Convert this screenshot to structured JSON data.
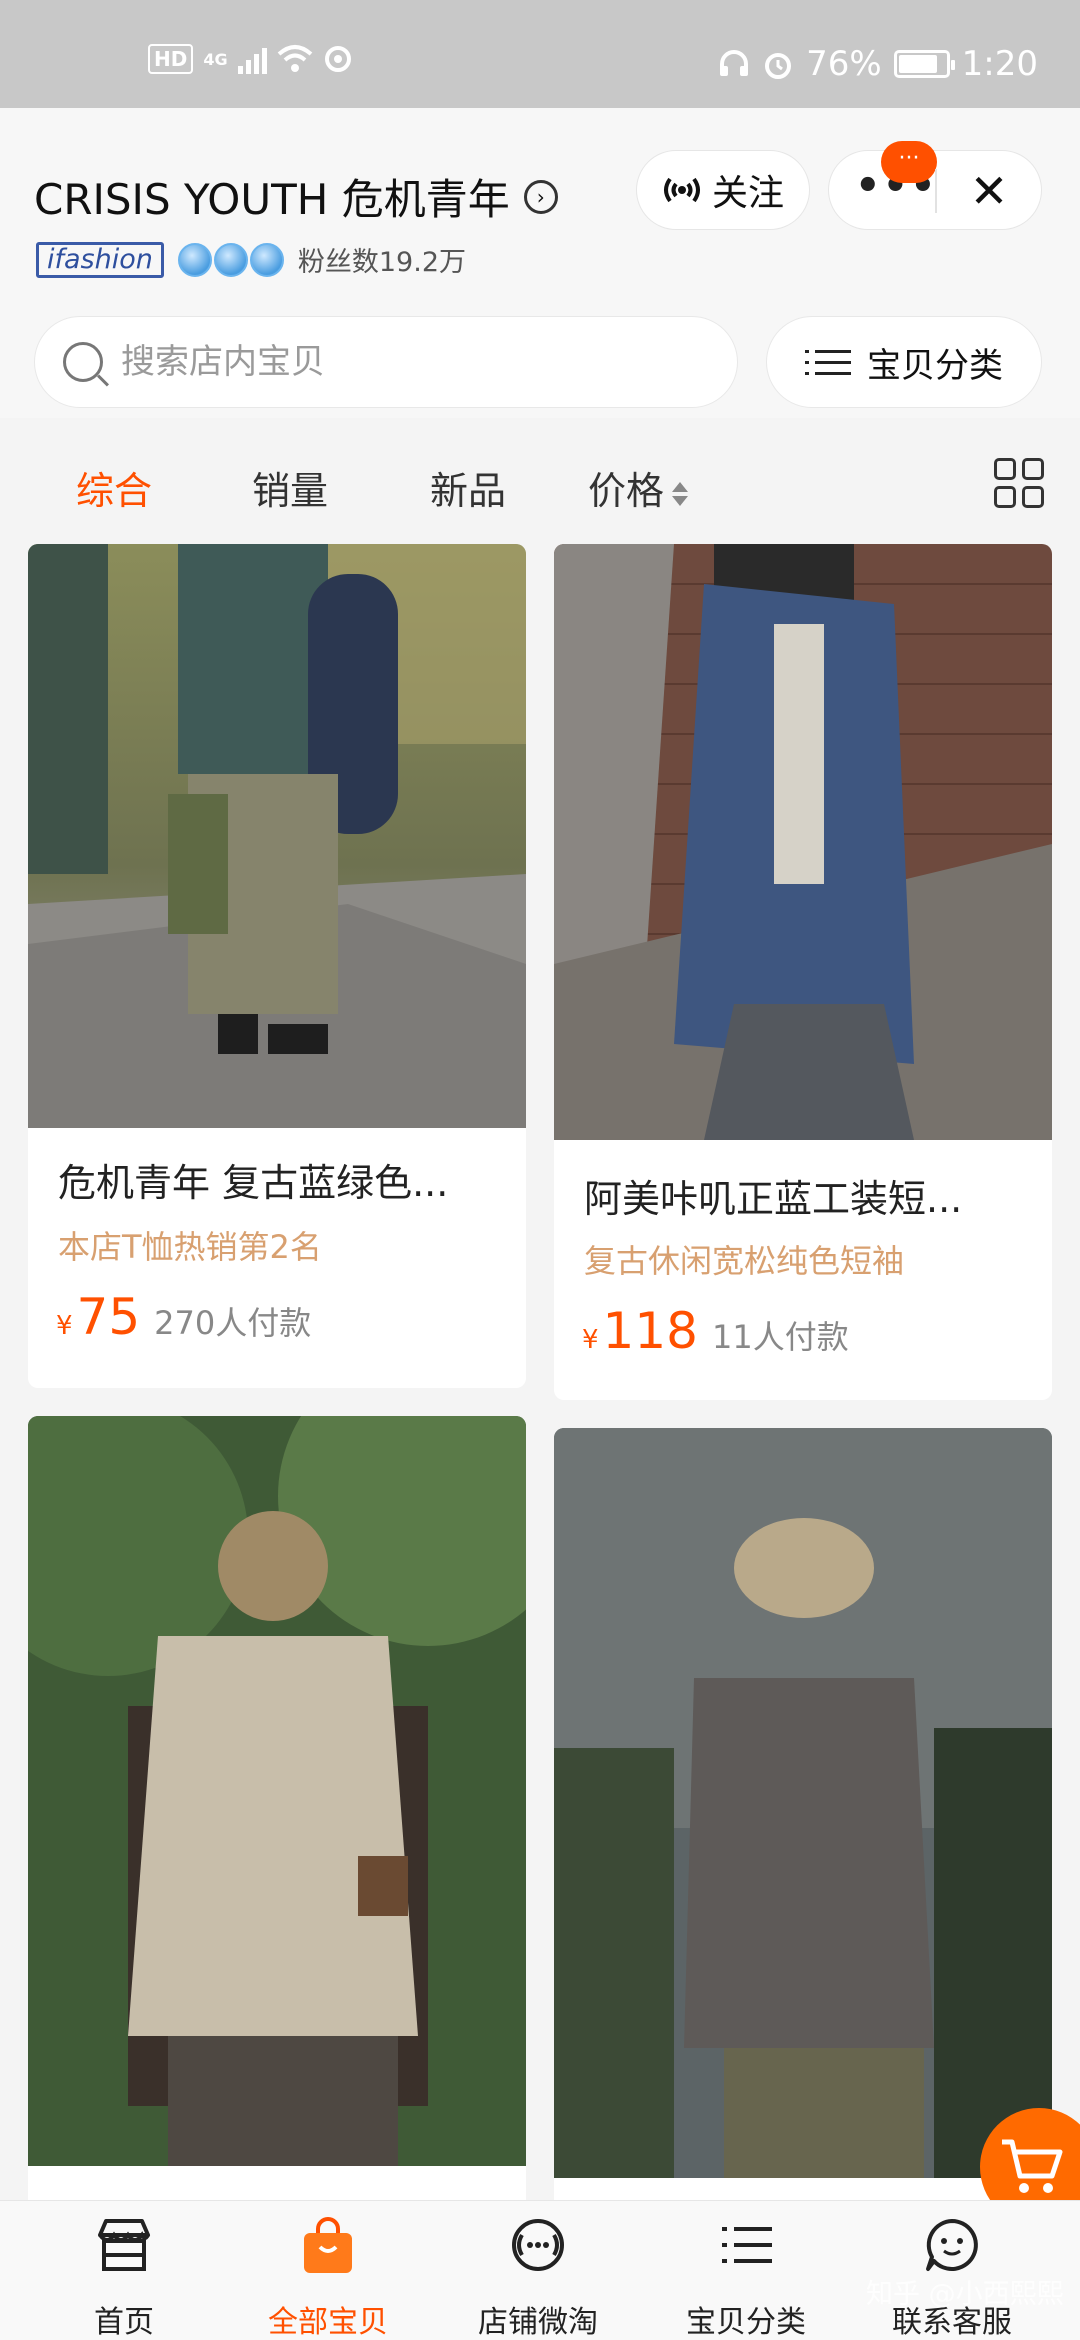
{
  "status_bar": {
    "left_chip": "HD",
    "network": "4G",
    "battery_percent": "76%",
    "battery_level": 0.76,
    "time": "1:20",
    "icons": [
      "hd-icon",
      "signal-icon",
      "wifi-icon",
      "sync-icon",
      "headset-icon",
      "alarm-icon",
      "battery-icon"
    ]
  },
  "header": {
    "shop_name": "CRISIS YOUTH 危机青年",
    "follow_label": "关注",
    "menu_badge": "···",
    "brand_badge": "ifashion",
    "crown_count": 3,
    "fans": "粉丝数19.2万"
  },
  "search": {
    "placeholder": "搜索店内宝贝",
    "category_label": "宝贝分类"
  },
  "sort_tabs": [
    {
      "label": "综合",
      "active": true
    },
    {
      "label": "销量",
      "active": false
    },
    {
      "label": "新品",
      "active": false
    },
    {
      "label": "价格",
      "active": false
    }
  ],
  "products": [
    {
      "title": "危机青年 复古蓝绿色...",
      "subtitle": "本店T恤热销第2名",
      "currency": "¥",
      "price": "75",
      "paid": "270人付款"
    },
    {
      "title": "阿美咔叽正蓝工装短...",
      "subtitle": "复古休闲宽松纯色短袖",
      "currency": "¥",
      "price": "118",
      "paid": "11人付款"
    }
  ],
  "bottom_nav": [
    {
      "label": "首页",
      "icon": "storefront-icon",
      "active": false
    },
    {
      "label": "全部宝贝",
      "icon": "shopping-bag-icon",
      "active": true
    },
    {
      "label": "店铺微淘",
      "icon": "broadcast-icon",
      "active": false
    },
    {
      "label": "宝贝分类",
      "icon": "list-icon",
      "active": false
    },
    {
      "label": "联系客服",
      "icon": "chat-face-icon",
      "active": false
    }
  ],
  "watermark": "知乎 @小西熙熙",
  "colors": {
    "accent": "#ff5000",
    "subtitle": "#d8a070",
    "status_bar": "#c8c8c8",
    "brand_blue": "#2e4f9e"
  }
}
